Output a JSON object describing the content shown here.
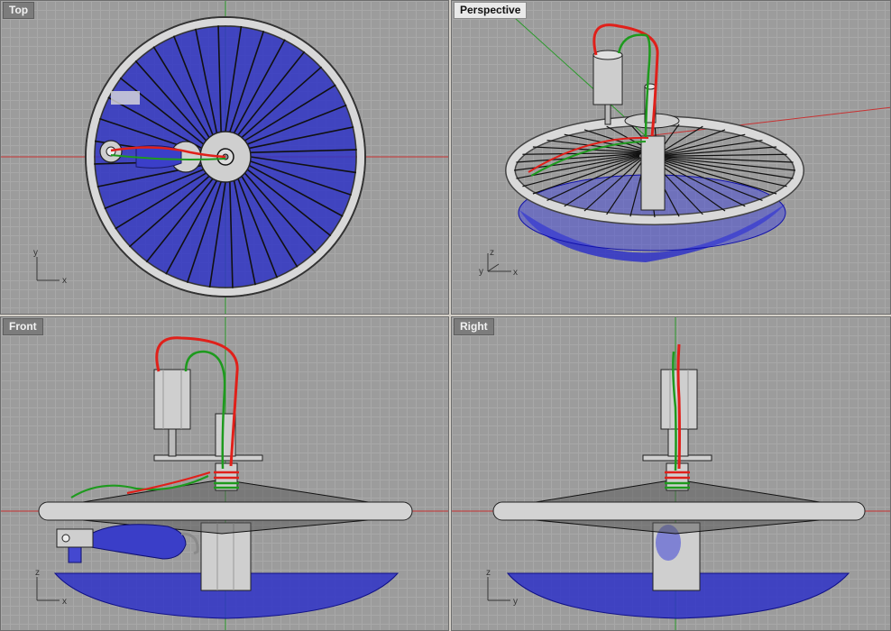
{
  "viewports": {
    "top": {
      "title": "Top",
      "axis_v": "y",
      "axis_h": "x"
    },
    "perspective": {
      "title": "Perspective",
      "axis_v": "z",
      "axis_d": "y",
      "axis_h": "x"
    },
    "front": {
      "title": "Front",
      "axis_v": "z",
      "axis_h": "x"
    },
    "right": {
      "title": "Right",
      "axis_v": "z",
      "axis_h": "y"
    }
  },
  "colors": {
    "viewport_bg": "#9c9c9c",
    "axis_x": "#c83232",
    "axis_y": "#2a9a2a",
    "basin": "#2f33c8",
    "wire_red": "#e0201a",
    "wire_green": "#1e9a1e",
    "metal": "#c9c9c9"
  }
}
